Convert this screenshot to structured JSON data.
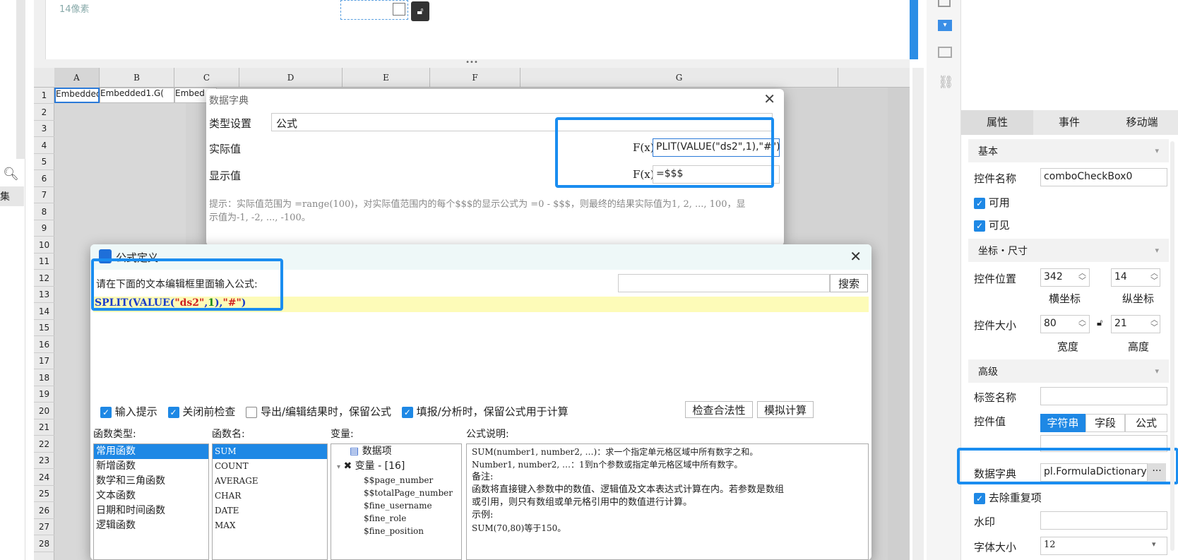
{
  "canvas": {
    "ruler_label": "14像素"
  },
  "sheet": {
    "columns": [
      "A",
      "B",
      "C",
      "D",
      "E",
      "F",
      "G"
    ],
    "rows": [
      "1",
      "2",
      "3",
      "4",
      "5",
      "6",
      "7",
      "8",
      "9",
      "10",
      "11",
      "12",
      "13",
      "14",
      "15",
      "16",
      "17",
      "18",
      "19",
      "20",
      "21",
      "22",
      "23",
      "24",
      "25",
      "26",
      "27",
      "28"
    ],
    "cells": {
      "a1": "Embedded",
      "b1": "Embedded1.G(",
      "c1": "Embed"
    }
  },
  "left_strip": {
    "label": "集"
  },
  "dict_dialog": {
    "title": "数据字典",
    "type_label": "类型设置",
    "type_value": "公式",
    "actual_label": "实际值",
    "actual_value": "PLIT(VALUE(\"ds2\",1),\"#\")",
    "display_label": "显示值",
    "display_value": "=$$$",
    "fx": "F(x)",
    "hint": "提示：实际值范围为 =range(100)，对实际值范围内的每个$$$的显示公式为 =0 - $$$，则最终的结果实际值为1, 2, ..., 100，显示值为-1, -2, ..., -100。"
  },
  "formula_dialog": {
    "title": "公式定义",
    "prompt": "请在下面的文本编辑框里面输入公式:",
    "formula_fn1": "SPLIT",
    "formula_fn2": "VALUE",
    "formula_str1": "\"ds2\"",
    "formula_num": "1",
    "formula_str2": "\"#\"",
    "search_button": "搜索",
    "options": [
      "输入提示",
      "关闭前检查",
      "导出/编辑结果时，保留公式",
      "填报/分析时，保留公式用于计算"
    ],
    "check_button": "检查合法性",
    "simulate_button": "模拟计算",
    "func_type_header": "函数类型:",
    "func_name_header": "函数名:",
    "var_header": "变量:",
    "desc_header": "公式说明:",
    "func_types": [
      "常用函数",
      "新增函数",
      "数学和三角函数",
      "文本函数",
      "日期和时间函数",
      "逻辑函数"
    ],
    "func_names": [
      "SUM",
      "COUNT",
      "AVERAGE",
      "CHAR",
      "DATE",
      "MAX"
    ],
    "vars_group1": "数据项",
    "vars_group2": "变量 - [16]",
    "vars": [
      "$$page_number",
      "$$totalPage_number",
      "$fine_username",
      "$fine_role",
      "$fine_position"
    ],
    "desc_lines": [
      "SUM(number1, number2, …)：求一个指定单元格区域中所有数字之和。",
      "Number1, number2, …：1到n个参数或指定单元格区域中所有数字。",
      "备注:",
      "函数将直接键入参数中的数值、逻辑值及文本表达式计算在内。若参数是数组",
      "或引用，则只有数组或单元格引用中的数值进行计算。",
      "示例:",
      "SUM(70,80)等于150。"
    ]
  },
  "right_panel": {
    "tabs": [
      "属性",
      "事件",
      "移动端"
    ],
    "basic": "基本",
    "widget_name_label": "控件名称",
    "widget_name": "comboCheckBox0",
    "enabled": "可用",
    "visible": "可见",
    "coords": "坐标・尺寸",
    "pos_label": "控件位置",
    "pos_x": "342",
    "pos_y": "14",
    "x_label": "横坐标",
    "y_label": "纵坐标",
    "size_label": "控件大小",
    "width": "80",
    "height": "21",
    "w_label": "宽度",
    "h_label": "高度",
    "advanced": "高级",
    "tag_label": "标签名称",
    "value_label": "控件值",
    "value_opts": [
      "字符串",
      "字段",
      "公式"
    ],
    "dict_label": "数据字典",
    "dict_value": "pl.FormulaDictionary",
    "dedupe": "去除重复项",
    "watermark": "水印",
    "fontsize_label": "字体大小",
    "fontsize": "12"
  }
}
